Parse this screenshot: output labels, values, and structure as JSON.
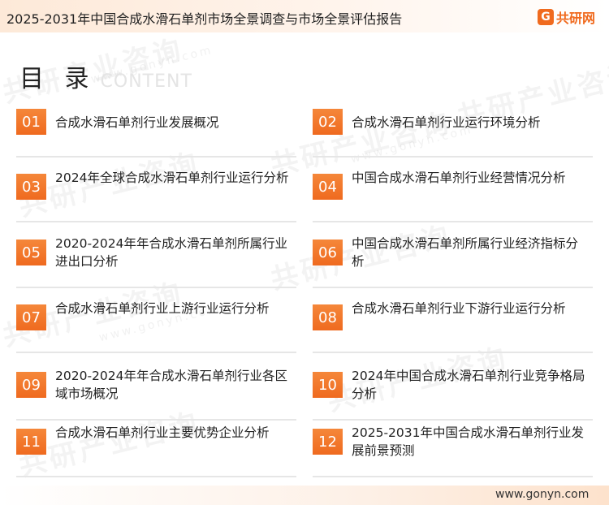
{
  "header": {
    "title": "2025-2031年中国合成水滑石单剂市场全景调查与市场全景评估报告",
    "logo_mark": "G",
    "logo_text": "共研网",
    "accent": "#f06a1e"
  },
  "toc": {
    "title": "目 录",
    "subtitle": "CONTENT"
  },
  "items": [
    {
      "num": "01",
      "label": "合成水滑石单剂行业发展概况"
    },
    {
      "num": "02",
      "label": "合成水滑石单剂行业运行环境分析"
    },
    {
      "num": "03",
      "label": "2024年全球合成水滑石单剂行业运行分析"
    },
    {
      "num": "04",
      "label": "中国合成水滑石单剂行业经营情况分析"
    },
    {
      "num": "05",
      "label": "2020-2024年年合成水滑石单剂所属行业进出口分析"
    },
    {
      "num": "06",
      "label": "中国合成水滑石单剂所属行业经济指标分析"
    },
    {
      "num": "07",
      "label": "合成水滑石单剂行业上游行业运行分析"
    },
    {
      "num": "08",
      "label": "合成水滑石单剂行业下游行业运行分析"
    },
    {
      "num": "09",
      "label": "2020-2024年年合成水滑石单剂行业各区域市场概况"
    },
    {
      "num": "10",
      "label": "2024年中国合成水滑石单剂行业竞争格局分析"
    },
    {
      "num": "11",
      "label": "合成水滑石单剂行业主要优势企业分析"
    },
    {
      "num": "12",
      "label": "2025-2031年中国合成水滑石单剂行业发展前景预测"
    }
  ],
  "footer": {
    "url": "www.gonyn.com"
  },
  "watermark": {
    "text": "共研产业咨询",
    "url_text": "www.gonyn.com"
  }
}
